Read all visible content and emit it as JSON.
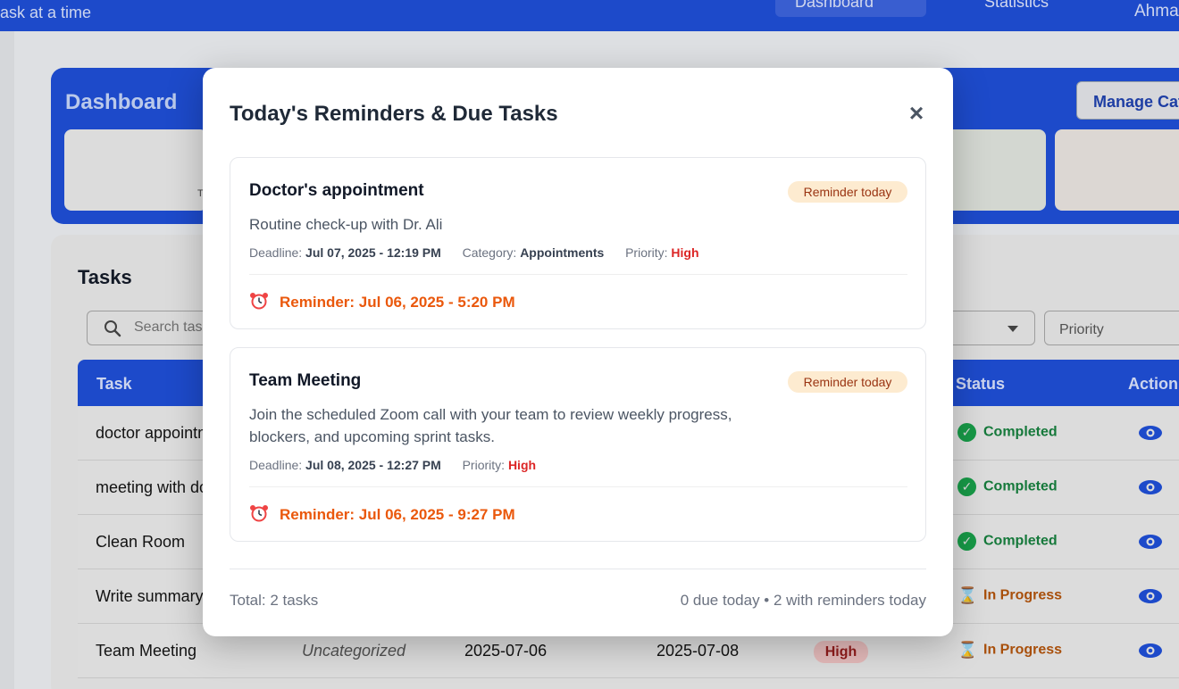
{
  "header": {
    "tagline": "ask at a time",
    "nav_dashboard": "Dashboard",
    "nav_statistics": "Statistics",
    "user": "Ahma"
  },
  "dashboard": {
    "title": "Dashboard",
    "manage_button": "Manage Cat",
    "stat_fragment": "T"
  },
  "tasks": {
    "title": "Tasks",
    "search_placeholder": "Search tas",
    "priority_placeholder": "Priority",
    "columns": {
      "task": "Task",
      "status": "Status",
      "actions": "Action"
    },
    "rows": [
      {
        "name": "doctor appointm",
        "status": "Completed"
      },
      {
        "name": "meeting with do",
        "status": "Completed"
      },
      {
        "name": "Clean Room",
        "status": "Completed"
      },
      {
        "name": "Write summary",
        "status": "In Progress"
      },
      {
        "name": "Team Meeting",
        "category": "Uncategorized",
        "created": "2025-07-06",
        "deadline": "2025-07-08",
        "priority": "High",
        "status": "In Progress"
      }
    ]
  },
  "modal": {
    "title": "Today's Reminders & Due Tasks",
    "close": "×",
    "cards": [
      {
        "title": "Doctor's appointment",
        "badge": "Reminder today",
        "description": "Routine check-up with Dr. Ali",
        "deadline_label": "Deadline:",
        "deadline": "Jul 07, 2025 - 12:19 PM",
        "category_label": "Category:",
        "category": "Appointments",
        "priority_label": "Priority:",
        "priority": "High",
        "reminder": "Reminder: Jul 06, 2025 - 5:20 PM"
      },
      {
        "title": "Team Meeting",
        "badge": "Reminder today",
        "description": "Join the scheduled Zoom call with your team to review weekly progress, blockers, and upcoming sprint tasks.",
        "deadline_label": "Deadline:",
        "deadline": "Jul 08, 2025 - 12:27 PM",
        "priority_label": "Priority:",
        "priority": "High",
        "reminder": "Reminder: Jul 06, 2025 - 9:27 PM"
      }
    ],
    "footer_total": "Total: 2 tasks",
    "footer_summary": "0 due today • 2 with reminders today"
  },
  "colors": {
    "brand": "#1d4ed8",
    "reminder": "#ea580c",
    "priority_high": "#dc2626",
    "completed": "#15803d",
    "in_progress": "#b45309"
  }
}
